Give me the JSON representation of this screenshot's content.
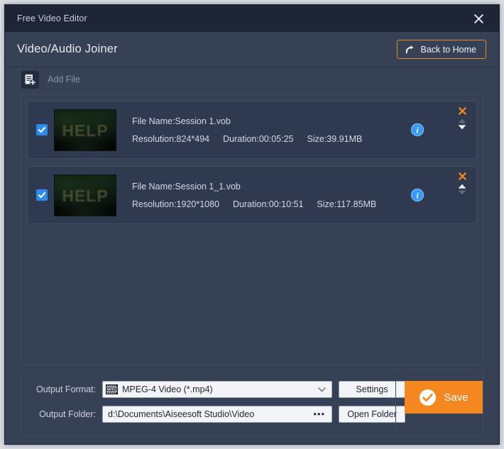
{
  "window": {
    "title": "Free Video Editor",
    "close_icon": "close-icon"
  },
  "header": {
    "page_title": "Video/Audio Joiner",
    "back_home_label": "Back to Home",
    "back_home_icon": "redo-arrow-icon",
    "accent_color": "#e08a28"
  },
  "toolbar": {
    "add_file_label": "Add File",
    "add_file_icon": "add-file-icon"
  },
  "file_list": {
    "rows": [
      {
        "checked": true,
        "thumbnail_text": "HELP",
        "file_name": "File Name:Session 1.vob",
        "resolution": "Resolution:824*494",
        "duration": "Duration:00:05:25",
        "size": "Size:39.91MB",
        "info_icon": "info-icon",
        "remove_icon": "close-x-icon",
        "move_up_icon": "triangle-up-icon",
        "move_down_icon": "triangle-down-icon",
        "move_up_enabled": false,
        "move_down_enabled": true
      },
      {
        "checked": true,
        "thumbnail_text": "HELP",
        "file_name": "File Name:Session 1_1.vob",
        "resolution": "Resolution:1920*1080",
        "duration": "Duration:00:10:51",
        "size": "Size:117.85MB",
        "info_icon": "info-icon",
        "remove_icon": "close-x-icon",
        "move_up_icon": "triangle-up-icon",
        "move_down_icon": "triangle-down-icon",
        "move_up_enabled": true,
        "move_down_enabled": false
      }
    ]
  },
  "output": {
    "format_label": "Output Format:",
    "format_value": "MPEG-4 Video (*.mp4)",
    "format_icon": "mpeg-film-icon",
    "settings_label": "Settings",
    "folder_label": "Output Folder:",
    "folder_value": "d:\\Documents\\Aiseesoft Studio\\Video",
    "browse_label": "•••",
    "open_folder_label": "Open Folder",
    "save_label": "Save",
    "save_icon": "check-circle-icon",
    "save_color": "#f4871f"
  }
}
